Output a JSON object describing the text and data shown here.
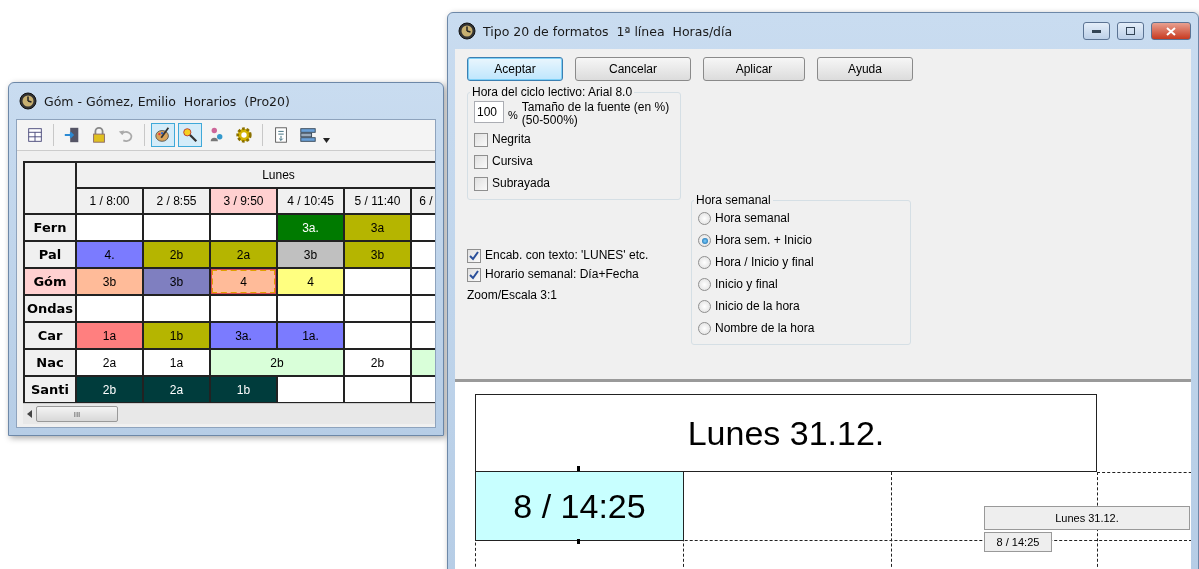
{
  "schedule_window": {
    "title": "Góm - Gómez, Emilio  Horarios  (Pro20)",
    "toolbar": [
      {
        "kind": "grid",
        "pressed": false
      },
      {
        "kind": "door",
        "pressed": false
      },
      {
        "kind": "lock",
        "pressed": false
      },
      {
        "kind": "undo",
        "pressed": false
      },
      {
        "kind": "palette",
        "pressed": true
      },
      {
        "kind": "magnifier",
        "pressed": true
      },
      {
        "kind": "people",
        "pressed": false
      },
      {
        "kind": "gear",
        "pressed": false
      },
      {
        "kind": "document",
        "pressed": false
      },
      {
        "kind": "monitor",
        "pressed": false
      }
    ],
    "day": "Lunes",
    "columns": [
      {
        "label": "1 / 8:00",
        "selected": false
      },
      {
        "label": "2 / 8:55",
        "selected": false
      },
      {
        "label": "3 / 9:50",
        "selected": true
      },
      {
        "label": "4 / 10:45",
        "selected": false
      },
      {
        "label": "5 / 11:40",
        "selected": false
      },
      {
        "label": "6 /",
        "selected": false
      }
    ],
    "rows": [
      {
        "name": "Fern",
        "selected": false,
        "cells": [
          {
            "color": "#ffffff"
          },
          {
            "color": "#ffffff"
          },
          {
            "color": "#ffffff"
          },
          {
            "text": "3a.",
            "color": "#007a00"
          },
          {
            "text": "3a",
            "color": "#b5b500"
          },
          {
            "color": "#ffffff"
          }
        ]
      },
      {
        "name": "Pal",
        "selected": false,
        "cells": [
          {
            "text": "4.",
            "color": "#7b7bff"
          },
          {
            "text": "2b",
            "color": "#b5b500"
          },
          {
            "text": "2a",
            "color": "#b5b500"
          },
          {
            "text": "3b",
            "color": "#c0c0c0"
          },
          {
            "text": "3b",
            "color": "#b5b500"
          },
          {
            "color": "#ffffff"
          }
        ]
      },
      {
        "name": "Góm",
        "selected": true,
        "cells": [
          {
            "text": "3b",
            "color": "#ffbb99"
          },
          {
            "text": "3b",
            "color": "#7f7fc0"
          },
          {
            "text": "4",
            "color": "#ffbb99",
            "selected": true
          },
          {
            "text": "4",
            "color": "#ffff80"
          },
          {
            "color": "#ffffff"
          },
          {
            "color": "#ffffff"
          }
        ]
      },
      {
        "name": "Ondas",
        "selected": false,
        "cells": [
          {
            "color": "#ffffff"
          },
          {
            "color": "#ffffff"
          },
          {
            "color": "#ffffff"
          },
          {
            "color": "#ffffff"
          },
          {
            "color": "#ffffff"
          },
          {
            "color": "#ffffff"
          }
        ]
      },
      {
        "name": "Car",
        "selected": false,
        "cells": [
          {
            "text": "1a",
            "color": "#ff7f7f"
          },
          {
            "text": "1b",
            "color": "#b5b500"
          },
          {
            "text": "3a.",
            "color": "#7b7bff"
          },
          {
            "text": "1a.",
            "color": "#7b7bff"
          },
          {
            "color": "#ffffff"
          },
          {
            "color": "#ffffff"
          }
        ]
      },
      {
        "name": "Nac",
        "selected": false,
        "cells": [
          {
            "text": "2a",
            "color": "#ffffff"
          },
          {
            "text": "1a",
            "color": "#ffffff"
          },
          {
            "text": "2b",
            "color": "#d9ffd9"
          },
          {
            "kind": "merged"
          },
          {
            "text": "2b",
            "color": "#ffffff"
          },
          {
            "color": "#d9ffd9"
          }
        ]
      },
      {
        "name": "Santi",
        "selected": false,
        "cells": [
          {
            "text": "2b",
            "color": "#003c3c"
          },
          {
            "text": "2a",
            "color": "#003c3c"
          },
          {
            "text": "1b",
            "color": "#003c3c"
          },
          {
            "color": "#ffffff"
          },
          {
            "color": "#ffffff"
          },
          {
            "color": "#ffffff"
          }
        ]
      }
    ],
    "scrollbar_grip": "III"
  },
  "format_dialog": {
    "title": "Tipo 20 de formatos  1ª línea  Horas/día",
    "buttons": [
      {
        "label": "Aceptar",
        "selected": true
      },
      {
        "label": "Cancelar",
        "selected": false
      },
      {
        "label": "Aplicar",
        "selected": false
      },
      {
        "label": "Ayuda",
        "selected": false
      }
    ],
    "font_group": {
      "legend": "Hora del ciclo lectivo: Arial 8.0",
      "size_value": "100",
      "percent_sign": "%",
      "size_label": "Tamaño de la fuente (en %) (50-500%)",
      "options": [
        {
          "label": "Negrita",
          "checked": false
        },
        {
          "label": "Cursiva",
          "checked": false
        },
        {
          "label": "Subrayada",
          "checked": false
        }
      ]
    },
    "options": [
      {
        "label": "Encab. con texto: 'LUNES' etc.",
        "checked": true
      },
      {
        "label": "Horario semanal: Día+Fecha",
        "checked": true
      }
    ],
    "zoom": "Zoom/Escala  3:1",
    "week_group": {
      "legend": "Hora semanal",
      "choices": [
        {
          "label": "Hora semanal",
          "selected": false
        },
        {
          "label": "Hora sem. + Inicio",
          "selected": true
        },
        {
          "label": "Hora / Inicio y final",
          "selected": false
        },
        {
          "label": "Inicio y final",
          "selected": false
        },
        {
          "label": "Inicio de la hora",
          "selected": false
        },
        {
          "label": "Nombre de la hora",
          "selected": false
        }
      ]
    },
    "preview": {
      "day_header": "Lunes 31.12.",
      "period": "8 / 14:25",
      "small_day_header": "Lunes 31.12.",
      "small_period": "8 / 14:25"
    }
  }
}
